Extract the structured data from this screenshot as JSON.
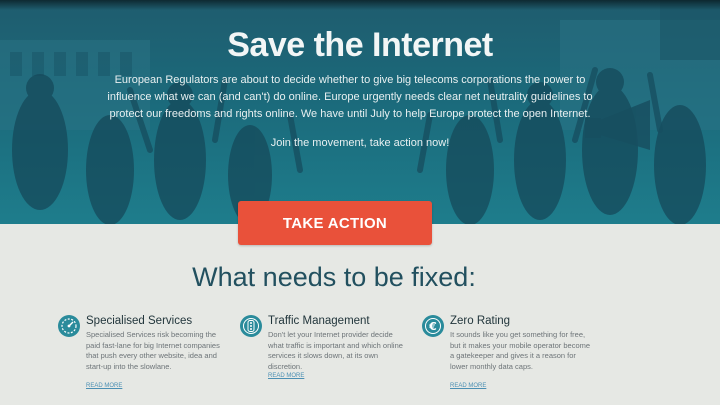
{
  "hero": {
    "title": "Save the Internet",
    "intro": "European Regulators are about to decide whether to give big telecoms corporations the power to influence what we can (and can't) do online. Europe urgently needs clear net neutrality guidelines to protect our freedoms and rights online. We have until July to help Europe protect the open Internet.",
    "cta_text": "Join the movement, take action now!",
    "button_label": "TAKE ACTION"
  },
  "section": {
    "heading": "What needs to be fixed:"
  },
  "features": [
    {
      "title": "Specialised Services",
      "icon": "gauge-icon",
      "description": "Specialised Services risk becoming the paid fast-lane for big Internet companies that push every other website, idea and start-up into the slowlane.",
      "read_more": "READ MORE"
    },
    {
      "title": "Traffic Management",
      "icon": "traffic-light-icon",
      "description": "Don't let your Internet provider decide what traffic is important and which online services it slows down, at its own discretion.",
      "read_more": "READ MORE"
    },
    {
      "title": "Zero Rating",
      "icon": "euro-icon",
      "description": "It sounds like you get something for free, but it makes your mobile operator become a gatekeeper and gives it a reason for lower monthly data caps.",
      "read_more": "READ MORE"
    }
  ],
  "colors": {
    "hero_bg": "#1b6a7b",
    "accent_button": "#e9513a",
    "heading": "#22505f",
    "icon_bg": "#2a8b9b",
    "link": "#4b8fb3"
  }
}
